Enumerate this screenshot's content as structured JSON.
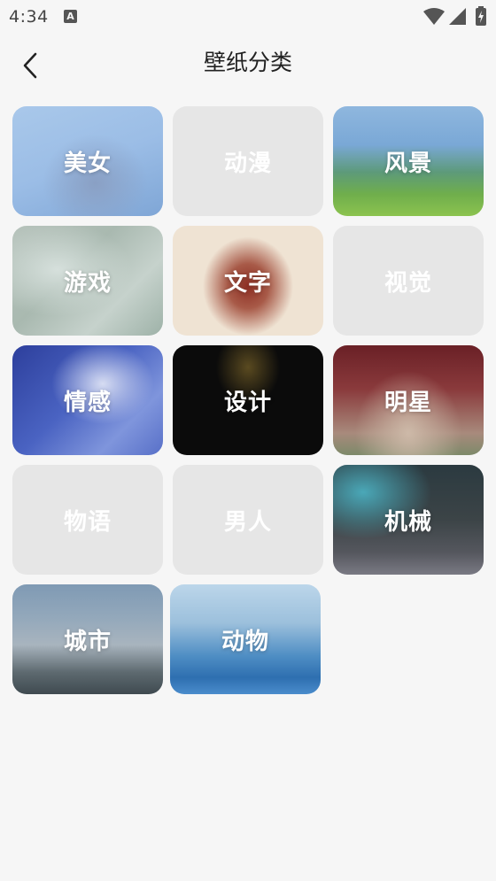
{
  "status": {
    "time": "4:34",
    "notif_glyph": "A"
  },
  "header": {
    "title": "壁纸分类",
    "back_icon": "chevron-left-icon"
  },
  "categories": [
    {
      "label": "美女"
    },
    {
      "label": "动漫"
    },
    {
      "label": "风景"
    },
    {
      "label": "游戏"
    },
    {
      "label": "文字"
    },
    {
      "label": "视觉"
    },
    {
      "label": "情感"
    },
    {
      "label": "设计"
    },
    {
      "label": "明星"
    },
    {
      "label": "物语"
    },
    {
      "label": "男人"
    },
    {
      "label": "机械"
    },
    {
      "label": "城市"
    },
    {
      "label": "动物"
    }
  ]
}
